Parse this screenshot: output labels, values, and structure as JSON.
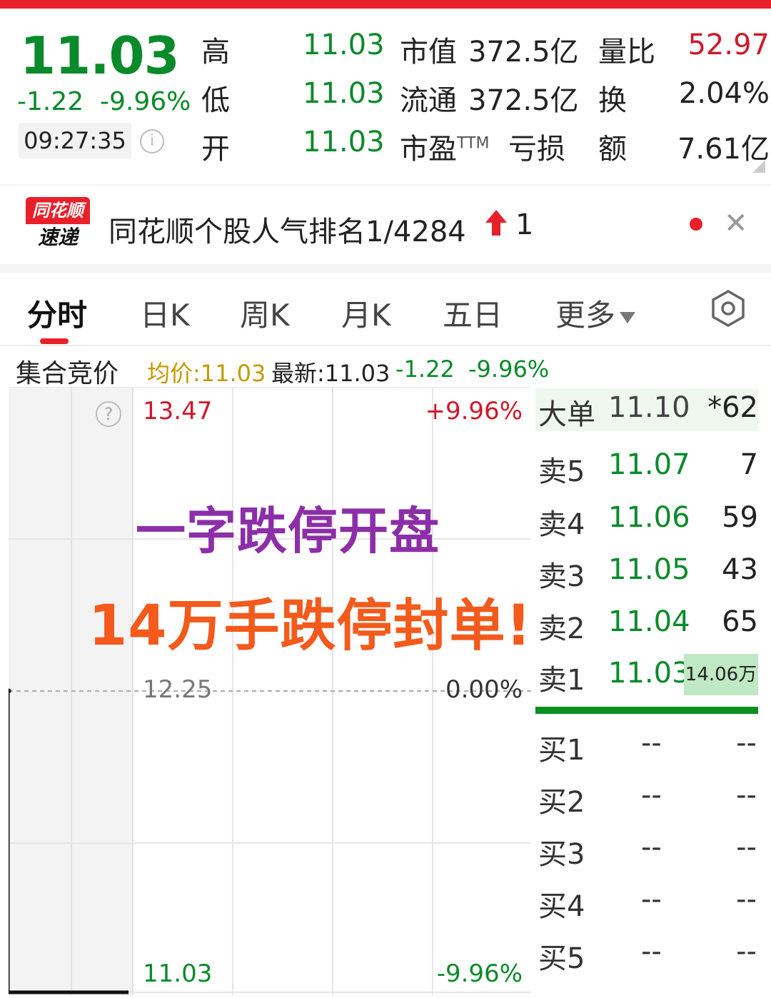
{
  "quote": {
    "price": "11.03",
    "change": "-1.22",
    "change_pct": "-9.96%",
    "time": "09:27:35",
    "info_icon": "info-icon",
    "high_label": "高",
    "high_value": "11.03",
    "low_label": "低",
    "low_value": "11.03",
    "open_label": "开",
    "open_value": "11.03",
    "mcap_label": "市值",
    "mcap_value": "372.5亿",
    "float_label": "流通",
    "float_value": "372.5亿",
    "pe_label": "市盈",
    "pe_sup": "TTM",
    "pe_value": "亏损",
    "volratio_label": "量比",
    "volratio_value": "52.97",
    "turnover_label": "换",
    "turnover_value": "2.04%",
    "amount_label": "额",
    "amount_value": "7.61亿"
  },
  "news": {
    "logo_top": "同花顺",
    "logo_bottom": "速递",
    "text": "同花顺个股人气排名1/4284",
    "arrow_icon": "red-up-arrow-icon",
    "rank_change": "1",
    "close_icon": "close-icon"
  },
  "tabs": [
    {
      "label": "分时",
      "active": true
    },
    {
      "label": "日K"
    },
    {
      "label": "周K"
    },
    {
      "label": "月K"
    },
    {
      "label": "五日"
    },
    {
      "label": "更多"
    }
  ],
  "settings_icon": "hexagon-settings-icon",
  "subheader": {
    "title": "集合竞价",
    "avg": "均价:11.03",
    "latest": "最新:11.03",
    "change": "-1.22",
    "change_pct": "-9.96%"
  },
  "chart": {
    "top_price": "13.47",
    "top_pct": "+9.96%",
    "mid_price": "12.25",
    "mid_pct": "0.00%",
    "bottom_price": "11.03",
    "bottom_pct": "-9.96%",
    "overlay_line1": "一字跌停开盘",
    "overlay_line2": "14万手跌停封单!",
    "help_icon": "question-icon"
  },
  "order_book": {
    "big_order_label": "大单",
    "big_order_price": "11.10",
    "big_order_vol": "*62",
    "sells": [
      {
        "label": "卖5",
        "price": "11.07",
        "vol": "7"
      },
      {
        "label": "卖4",
        "price": "11.06",
        "vol": "59"
      },
      {
        "label": "卖3",
        "price": "11.05",
        "vol": "43"
      },
      {
        "label": "卖2",
        "price": "11.04",
        "vol": "65"
      },
      {
        "label": "卖1",
        "price": "11.03",
        "vol": "14.06万"
      }
    ],
    "buys": [
      {
        "label": "买1",
        "price": "--",
        "vol": "--"
      },
      {
        "label": "买2",
        "price": "--",
        "vol": "--"
      },
      {
        "label": "买3",
        "price": "--",
        "vol": "--"
      },
      {
        "label": "买4",
        "price": "--",
        "vol": "--"
      },
      {
        "label": "买5",
        "price": "--",
        "vol": "--"
      }
    ]
  },
  "colors": {
    "down": "#0a8a2a",
    "up": "#d0182a",
    "brand": "#e8202a",
    "avg": "#c49a00",
    "overlay1": "#8c2ea8",
    "overlay2": "#f35a1c"
  }
}
